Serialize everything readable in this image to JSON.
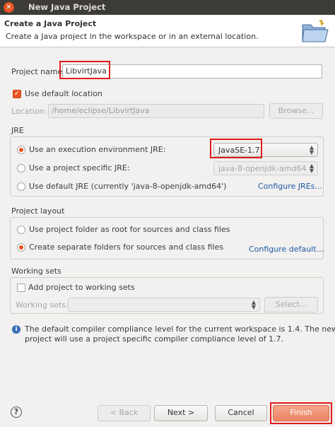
{
  "window": {
    "title": "New Java Project"
  },
  "header": {
    "title": "Create a Java Project",
    "message": "Create a Java project in the workspace or in an external location."
  },
  "project": {
    "name_label": "Project name:",
    "name_value": "LibvirtJava"
  },
  "location": {
    "use_default_label": "Use default location",
    "use_default_checked": true,
    "label": "Location:",
    "value": "/home/eclipse/LibvirtJava",
    "browse_label": "Browse..."
  },
  "jre": {
    "group_title": "JRE",
    "option_env_label": "Use an execution environment JRE:",
    "option_env_value": "JavaSE-1.7",
    "option_specific_label": "Use a project specific JRE:",
    "option_specific_value": "java-8-openjdk-amd64",
    "option_default_label": "Use default JRE (currently 'java-8-openjdk-amd64')",
    "configure_link": "Configure JREs...",
    "selected": "env"
  },
  "layout": {
    "group_title": "Project layout",
    "option_root_label": "Use project folder as root for sources and class files",
    "option_separate_label": "Create separate folders for sources and class files",
    "configure_link": "Configure default...",
    "selected": "separate"
  },
  "working_sets": {
    "group_title": "Working sets",
    "add_label": "Add project to working sets",
    "add_checked": false,
    "sets_label": "Working sets:",
    "select_label": "Select..."
  },
  "info": {
    "message_line1": "The default compiler compliance level for the current workspace is 1.4. The new",
    "message_line2": "project will use a project specific compiler compliance level of 1.7."
  },
  "buttons": {
    "back": "< Back",
    "next": "Next >",
    "cancel": "Cancel",
    "finish": "Finish"
  },
  "colors": {
    "accent": "#e95420",
    "highlight": "#e21b1b",
    "link": "#1f5aa6"
  }
}
